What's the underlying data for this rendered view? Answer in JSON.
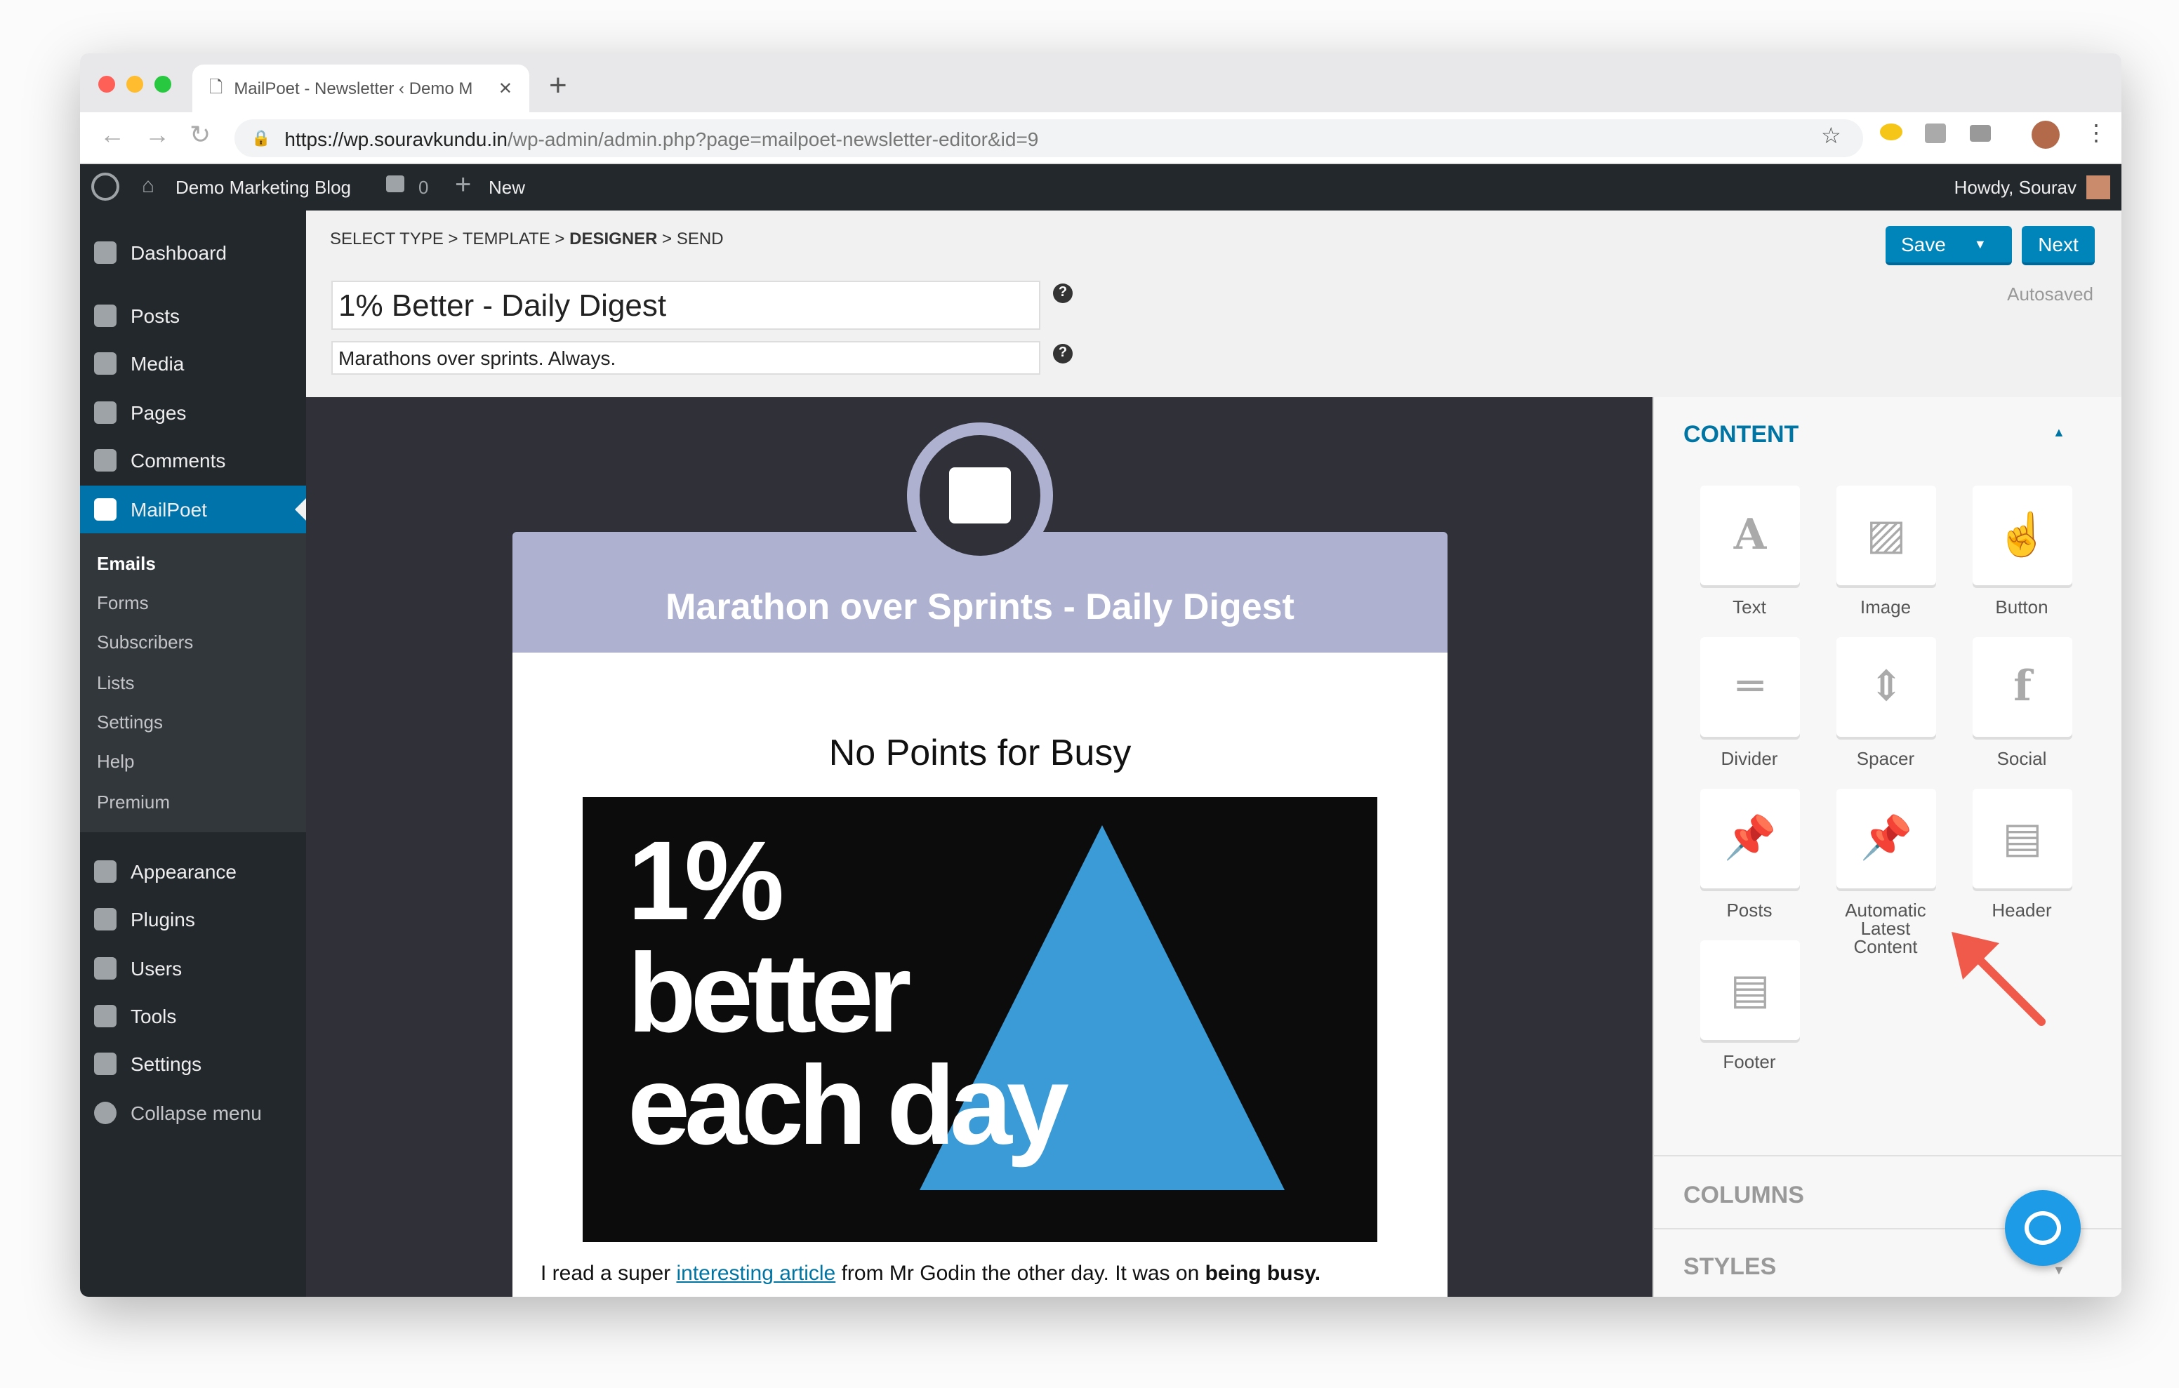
{
  "browser": {
    "tab_title": "MailPoet - Newsletter ‹ Demo M",
    "url_host": "https://wp.souravkundu.in",
    "url_path": "/wp-admin/admin.php?page=mailpoet-newsletter-editor&id=9"
  },
  "adminbar": {
    "site": "Demo Marketing Blog",
    "comments": "0",
    "new": "New",
    "howdy": "Howdy, Sourav"
  },
  "sidebar": {
    "items": [
      {
        "label": "Dashboard"
      },
      {
        "label": "Posts"
      },
      {
        "label": "Media"
      },
      {
        "label": "Pages"
      },
      {
        "label": "Comments"
      },
      {
        "label": "MailPoet"
      }
    ],
    "sub": [
      {
        "label": "Emails"
      },
      {
        "label": "Forms"
      },
      {
        "label": "Subscribers"
      },
      {
        "label": "Lists"
      },
      {
        "label": "Settings"
      },
      {
        "label": "Help"
      },
      {
        "label": "Premium"
      }
    ],
    "items2": [
      {
        "label": "Appearance"
      },
      {
        "label": "Plugins"
      },
      {
        "label": "Users"
      },
      {
        "label": "Tools"
      },
      {
        "label": "Settings"
      },
      {
        "label": "Collapse menu"
      }
    ]
  },
  "header": {
    "steps": [
      "SELECT TYPE",
      "TEMPLATE",
      "DESIGNER",
      "SEND"
    ],
    "sep": " > ",
    "subject": "1% Better - Daily Digest",
    "preheader": "Marathons over sprints. Always.",
    "save": "Save",
    "next": "Next",
    "status": "Autosaved",
    "help": "?"
  },
  "email": {
    "banner": "Marathon over Sprints - Daily Digest",
    "heading": "No Points for Busy",
    "image_text": [
      "1%",
      "better",
      "each day"
    ],
    "para_before": "I read a super ",
    "para_link": "interesting article",
    "para_mid": " from Mr Godin the other day. It was on ",
    "para_bold": "being busy."
  },
  "panel": {
    "content": "CONTENT",
    "columns": "COLUMNS",
    "styles": "STYLES",
    "blocks": [
      {
        "label": "Text"
      },
      {
        "label": "Image"
      },
      {
        "label": "Button"
      },
      {
        "label": "Divider"
      },
      {
        "label": "Spacer"
      },
      {
        "label": "Social"
      },
      {
        "label": "Posts"
      },
      {
        "label": "Automatic Latest Content"
      },
      {
        "label": "Header"
      },
      {
        "label": "Footer"
      }
    ]
  },
  "colors": {
    "wp_dark": "#23282d",
    "accent": "#0085ba",
    "banner": "#aeb1d0",
    "panel_heading": "#0074a2"
  }
}
